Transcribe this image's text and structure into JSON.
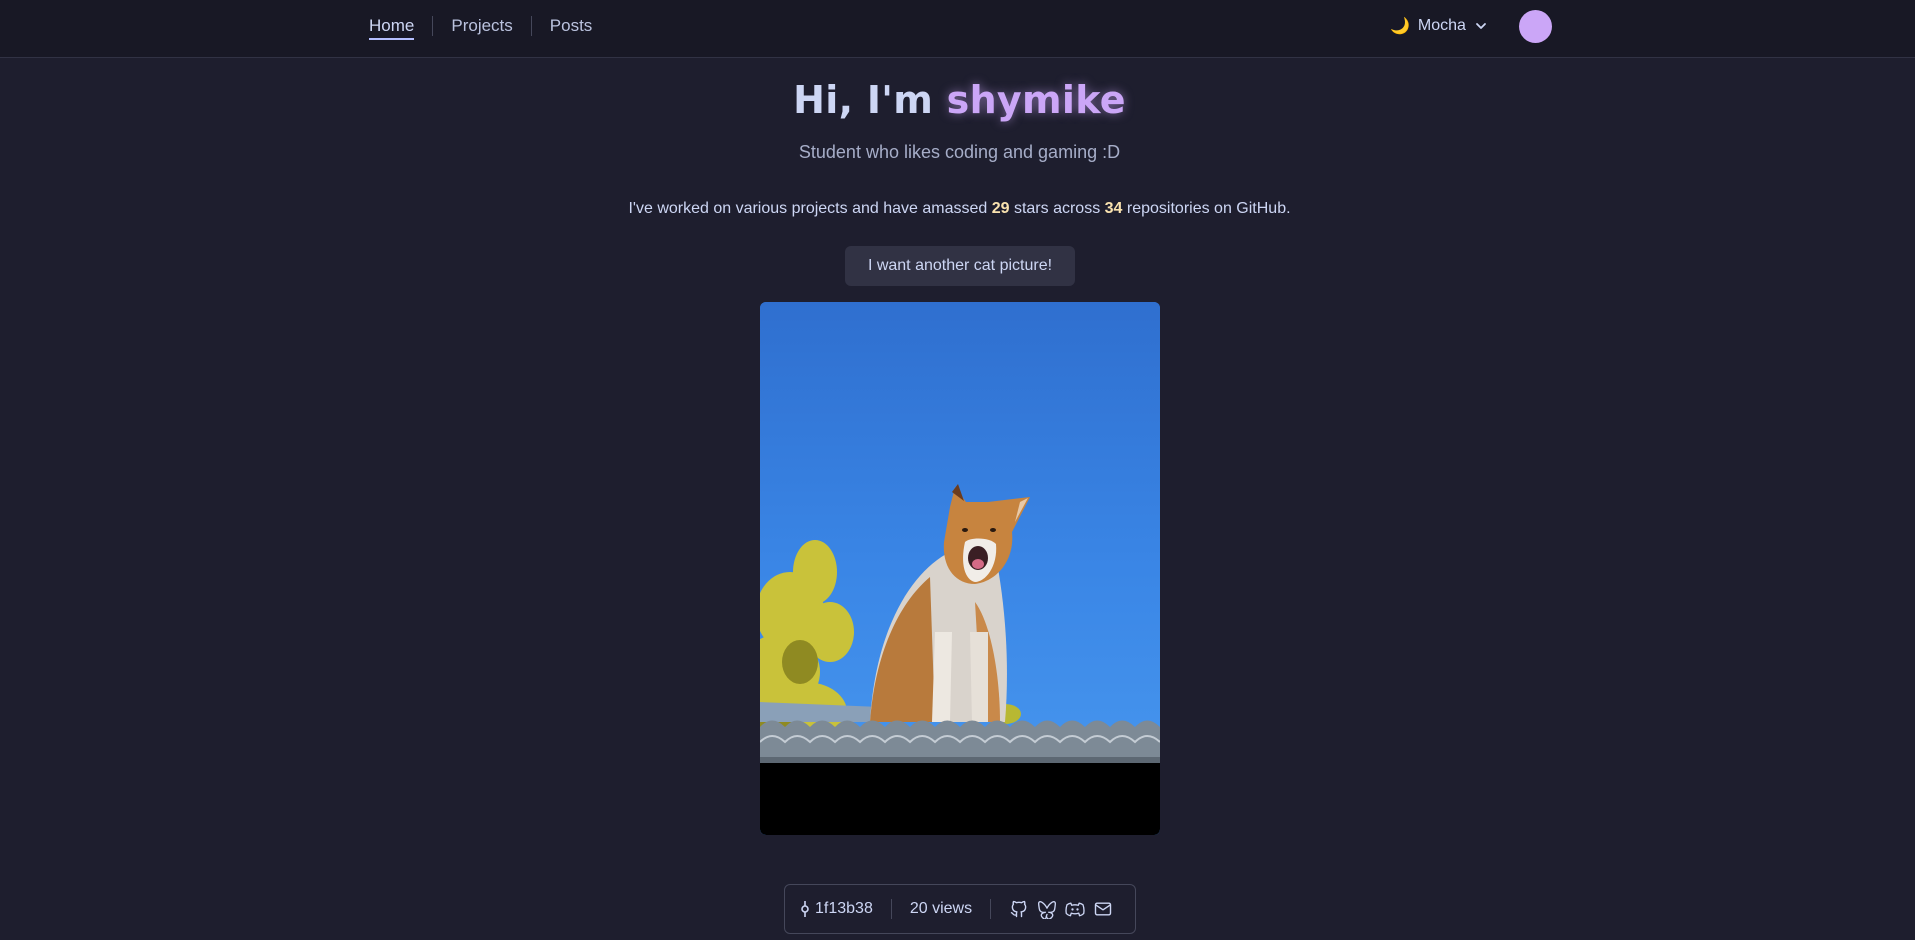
{
  "nav": {
    "items": [
      {
        "label": "Home",
        "active": true
      },
      {
        "label": "Projects",
        "active": false
      },
      {
        "label": "Posts",
        "active": false
      }
    ],
    "theme_label": "Mocha",
    "theme_icon": "moon-icon"
  },
  "hero": {
    "greeting": "Hi, I'm ",
    "name": "shymike",
    "subtitle": "Student who likes coding and gaming :D"
  },
  "stats": {
    "prefix": "I've worked on various projects and have amassed ",
    "stars": "29",
    "middle": " stars across ",
    "repos": "34",
    "suffix": " repositories on GitHub."
  },
  "cat_button_label": "I want another cat picture!",
  "footer": {
    "commit": "1f13b38",
    "views": "20 views",
    "icons": [
      "github-icon",
      "bluesky-icon",
      "discord-icon",
      "mail-icon"
    ]
  },
  "colors": {
    "background": "#1e1e2e",
    "topbar": "#181825",
    "accent": "#cba6f7",
    "highlight": "#f9e2af",
    "text": "#cdd6f4"
  }
}
